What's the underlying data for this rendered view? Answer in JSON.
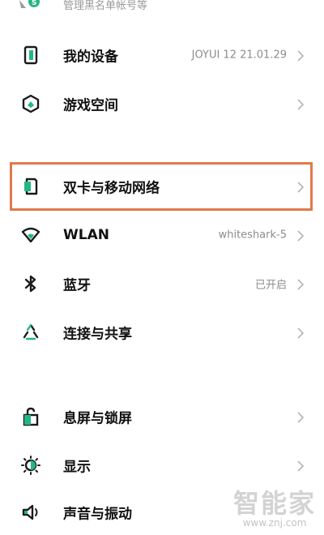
{
  "top_row": {
    "subtext": "管理黑名单帐号等",
    "icon": "account-security-icon"
  },
  "groups": [
    {
      "items": [
        {
          "id": "my-device",
          "label": "我的设备",
          "value": "JOYUI 12 21.01.29",
          "icon": "phone-device-icon"
        },
        {
          "id": "game-space",
          "label": "游戏空间",
          "value": "",
          "icon": "game-space-icon"
        }
      ]
    },
    {
      "items": [
        {
          "id": "dual-sim",
          "label": "双卡与移动网络",
          "value": "",
          "icon": "sim-card-icon",
          "highlighted": true
        },
        {
          "id": "wlan",
          "label": "WLAN",
          "value": "whiteshark-5",
          "icon": "wifi-icon"
        },
        {
          "id": "bluetooth",
          "label": "蓝牙",
          "value": "已开启",
          "icon": "bluetooth-icon"
        },
        {
          "id": "connection-share",
          "label": "连接与共享",
          "value": "",
          "icon": "share-connection-icon"
        }
      ]
    },
    {
      "items": [
        {
          "id": "lock-screen",
          "label": "息屏与锁屏",
          "value": "",
          "icon": "lock-icon"
        },
        {
          "id": "display",
          "label": "显示",
          "value": "",
          "icon": "display-brightness-icon"
        },
        {
          "id": "sound-vibration",
          "label": "声音与振动",
          "value": "",
          "icon": "speaker-icon"
        }
      ]
    }
  ],
  "watermark": {
    "brand": "智能家",
    "url": "www.znj.com"
  },
  "colors": {
    "highlight_border": "#e07a4b",
    "icon_accent": "#23b783",
    "icon_dark": "#1a1a1a"
  }
}
